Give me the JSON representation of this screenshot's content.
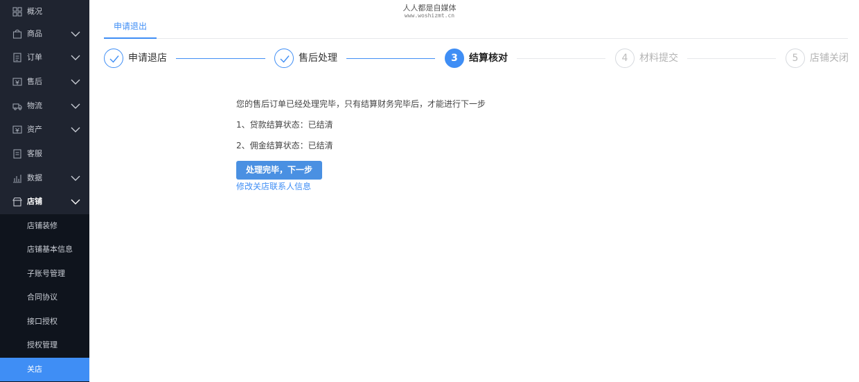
{
  "watermark": {
    "line1": "人人都是自媒体",
    "line2": "www.woshizmt.cn"
  },
  "sidebar": {
    "items": [
      {
        "label": "概况",
        "icon": "grid-icon",
        "chevron": false
      },
      {
        "label": "商品",
        "icon": "shopping-bag-icon",
        "chevron": true
      },
      {
        "label": "订单",
        "icon": "document-icon",
        "chevron": true
      },
      {
        "label": "售后",
        "icon": "after-sales-icon",
        "chevron": true
      },
      {
        "label": "物流",
        "icon": "truck-icon",
        "chevron": true
      },
      {
        "label": "资产",
        "icon": "wallet-icon",
        "chevron": true
      },
      {
        "label": "客服",
        "icon": "headset-icon",
        "chevron": false
      },
      {
        "label": "数据",
        "icon": "bar-chart-icon",
        "chevron": true
      },
      {
        "label": "店铺",
        "icon": "store-icon",
        "chevron": true
      }
    ],
    "submenu": [
      {
        "label": "店铺装修"
      },
      {
        "label": "店铺基本信息"
      },
      {
        "label": "子账号管理"
      },
      {
        "label": "合同协议"
      },
      {
        "label": "接口授权"
      },
      {
        "label": "授权管理"
      },
      {
        "label": "关店"
      }
    ]
  },
  "tabs": [
    {
      "label": "申请退出"
    }
  ],
  "steps": [
    {
      "number": "1",
      "label": "申请退店",
      "status": "done"
    },
    {
      "number": "2",
      "label": "售后处理",
      "status": "done"
    },
    {
      "number": "3",
      "label": "结算核对",
      "status": "current"
    },
    {
      "number": "4",
      "label": "材料提交",
      "status": "pending"
    },
    {
      "number": "5",
      "label": "店铺关闭",
      "status": "pending"
    }
  ],
  "content": {
    "message": "您的售后订单已经处理完毕，只有结算财务完毕后，才能进行下一步",
    "status_lines": [
      "1、贷款结算状态：已结清",
      "2、佣金结算状态：已结清"
    ],
    "next_button": "处理完毕，下一步",
    "modify_link": "修改关店联系人信息"
  },
  "colors": {
    "accent": "#3f8ef5",
    "sidebar_bg": "#1f2430",
    "submenu_bg": "#0f141d"
  }
}
